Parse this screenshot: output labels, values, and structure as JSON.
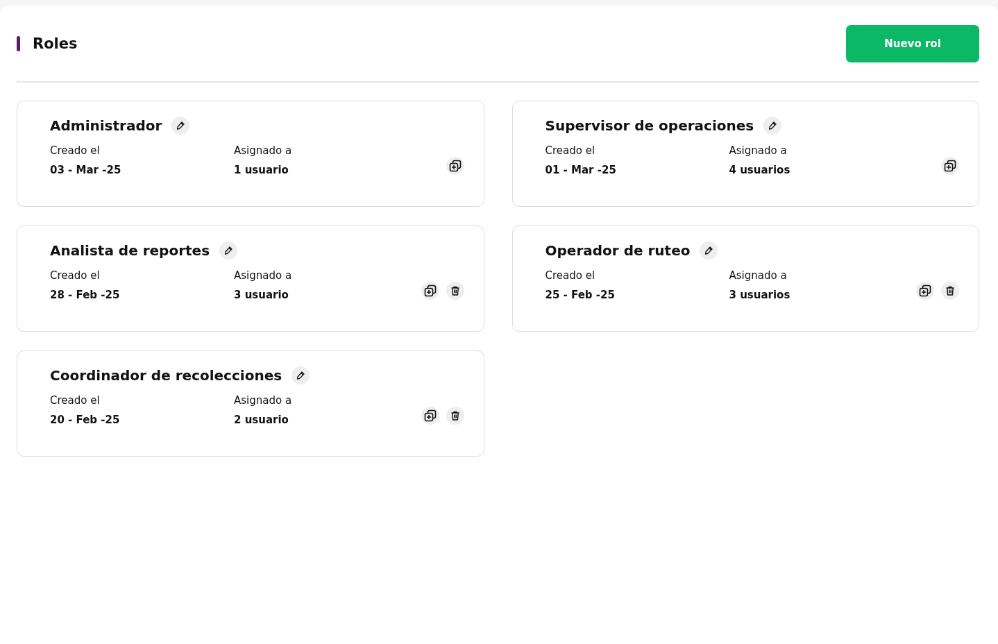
{
  "header": {
    "title": "Roles",
    "button": "Nuevo rol"
  },
  "roles": [
    {
      "name": "Administrador",
      "created_label": "Creado el",
      "created": "03 - Mar -25",
      "assigned_label": "Asignado a",
      "assigned": "1 usuario",
      "deletable": false
    },
    {
      "name": "Supervisor de operaciones",
      "created_label": "Creado el",
      "created": "01 - Mar -25",
      "assigned_label": "Asignado a",
      "assigned": "4 usuarios",
      "deletable": false
    },
    {
      "name": "Analista de reportes",
      "created_label": "Creado el",
      "created": "28 - Feb -25",
      "assigned_label": "Asignado a",
      "assigned": "3 usuario",
      "deletable": true
    },
    {
      "name": "Operador de ruteo",
      "created_label": "Creado el",
      "created": "25 - Feb -25",
      "assigned_label": "Asignado a",
      "assigned": "3 usuarios",
      "deletable": true
    },
    {
      "name": "Coordinador de recolecciones",
      "created_label": "Creado el",
      "created": "20 - Feb -25",
      "assigned_label": "Asignado a",
      "assigned": "2 usuario",
      "deletable": true
    }
  ]
}
